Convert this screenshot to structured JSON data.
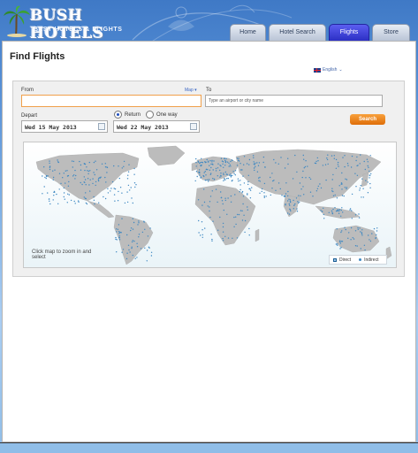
{
  "brand": {
    "name": "BUSH HOTELS",
    "tagline": "BEST HOTELS & FLIGHTS"
  },
  "tabs": [
    {
      "label": "Home",
      "active": false
    },
    {
      "label": "Hotel Search",
      "active": false
    },
    {
      "label": "Flights",
      "active": true
    },
    {
      "label": "Store",
      "active": false
    }
  ],
  "page": {
    "title": "Find Flights"
  },
  "language": {
    "selected": "English",
    "icon": "uk-flag-icon"
  },
  "search": {
    "from_label": "From",
    "map_link": "Map",
    "from_value": "",
    "to_label": "To",
    "to_placeholder": "Type an airport or city name",
    "depart_label": "Depart",
    "depart_value": "Wed 15 May 2013",
    "trip_type": {
      "return_label": "Return",
      "oneway_label": "One way",
      "selected": "Return"
    },
    "return_value": "Wed 22 May 2013",
    "search_button": "Search"
  },
  "map": {
    "hint": "Click map to zoom in and select",
    "legend": {
      "direct": "Direct",
      "indirect": "Indirect"
    }
  },
  "colors": {
    "accent": "#f28c22",
    "active_tab": "#3a3dd8",
    "land": "#bcbcbc",
    "airport_dot": "#3e88c2"
  }
}
